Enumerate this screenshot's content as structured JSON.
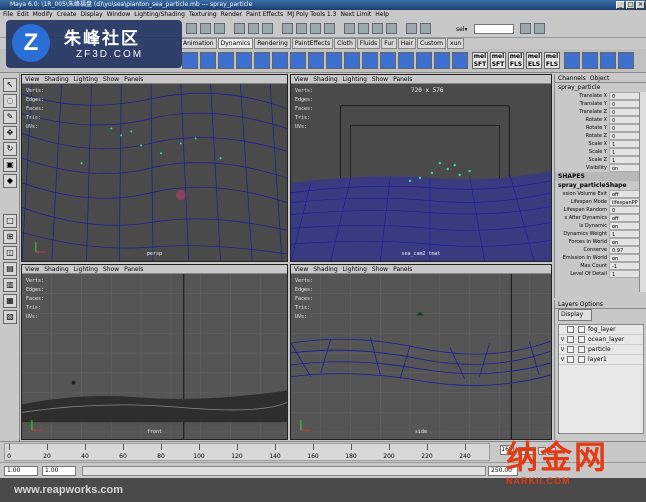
{
  "window": {
    "title": "Maya 6.0: \\1R_005\\朱峰福盘 (d)\\yu\\sea\\pianton_sea_particle.mb  ---  spray_particle",
    "buttons": [
      "_",
      "□",
      "×"
    ]
  },
  "menubar": [
    "File",
    "Edit",
    "Modify",
    "Create",
    "Display",
    "Window",
    "Lighting/Shading",
    "Texturing",
    "Render",
    "Paint Effects",
    "MJ Poly Tools 1.3",
    "Next Limit",
    "Help"
  ],
  "statusline": {
    "set_label": "sel▾",
    "set_value": ""
  },
  "shelf": {
    "tabs": [
      "Animation",
      "Dynamics",
      "Rendering",
      "PaintEffects",
      "Cloth",
      "Fluids",
      "Fur",
      "Hair",
      "Custom",
      "xun"
    ],
    "active_tab": "Dynamics",
    "text_icons": [
      "mel",
      "mel",
      "mel",
      "mel",
      "mel"
    ],
    "text_icon_sub": [
      "SFT",
      "SFT",
      "FLS",
      "ELS",
      "FLS"
    ]
  },
  "viewports": [
    {
      "menu": [
        "View",
        "Shading",
        "Lighting",
        "Show",
        "Panels"
      ],
      "label": "persp",
      "hud_labels": [
        "Verts:",
        "Edges:",
        "Faces:",
        "Tris:",
        "UVs:"
      ]
    },
    {
      "menu": [
        "View",
        "Shading",
        "Lighting",
        "Show",
        "Panels"
      ],
      "label": "sea_cam2 tmat",
      "resolution": "720 x 576",
      "hud_labels": [
        "Verts:",
        "Edges:",
        "Faces:",
        "Tris:",
        "UVs:"
      ]
    },
    {
      "menu": [
        "View",
        "Shading",
        "Lighting",
        "Show",
        "Panels"
      ],
      "label": "front",
      "hud_labels": [
        "Verts:",
        "Edges:",
        "Faces:",
        "Tris:",
        "UVs:"
      ]
    },
    {
      "menu": [
        "View",
        "Shading",
        "Lighting",
        "Show",
        "Panels"
      ],
      "label": "side",
      "hud_labels": [
        "Verts:",
        "Edges:",
        "Faces:",
        "Tris:",
        "UVs:"
      ]
    }
  ],
  "channelbox": {
    "tabs": [
      "Channels",
      "Object"
    ],
    "object": "spray_particle",
    "rows": [
      {
        "label": "Translate X",
        "value": "0"
      },
      {
        "label": "Translate Y",
        "value": "0"
      },
      {
        "label": "Translate Z",
        "value": "0"
      },
      {
        "label": "Rotate X",
        "value": "0"
      },
      {
        "label": "Rotate Y",
        "value": "0"
      },
      {
        "label": "Rotate Z",
        "value": "0"
      },
      {
        "label": "Scale X",
        "value": "1"
      },
      {
        "label": "Scale Y",
        "value": "1"
      },
      {
        "label": "Scale Z",
        "value": "1"
      },
      {
        "label": "Visibility",
        "value": "on"
      }
    ],
    "shapes_header": "SHAPES",
    "shape_name": "spray_particleShape",
    "shape_rows": [
      {
        "label": "ssion Volume Exit",
        "value": "off"
      },
      {
        "label": "Lifespan Mode",
        "value": "lifespanPP o"
      },
      {
        "label": "Lifespan Random",
        "value": "0"
      },
      {
        "label": "s After Dynamics",
        "value": "off"
      },
      {
        "label": "Is Dynamic",
        "value": "on"
      },
      {
        "label": "Dynamics Weight",
        "value": "1"
      },
      {
        "label": "Forces In World",
        "value": "on"
      },
      {
        "label": "Conserve",
        "value": "0.97"
      },
      {
        "label": "Emission In World",
        "value": "on"
      },
      {
        "label": "Max Count",
        "value": "-1"
      },
      {
        "label": "Level Of Detail",
        "value": "1"
      }
    ]
  },
  "layers": {
    "header": "Layers  Options",
    "display": "Display",
    "items": [
      {
        "v": "",
        "name": "fog_layer"
      },
      {
        "v": "V",
        "name": "ocean_layer"
      },
      {
        "v": "V",
        "name": "particle"
      },
      {
        "v": "V",
        "name": "layer1"
      }
    ]
  },
  "timeslider": {
    "ticks": [
      "0",
      "20",
      "40",
      "60",
      "80",
      "100",
      "120",
      "140",
      "160",
      "180",
      "200",
      "220",
      "240"
    ],
    "current": "169"
  },
  "rangeslider": {
    "start": "1.00",
    "playback_start": "1.00",
    "end": "250.00"
  },
  "watermarks": {
    "logo1_cn": "朱峰社区",
    "logo1_en": "ZF3D.COM",
    "logo1_mark": "Z",
    "logo2_cn": "纳金网",
    "logo2_en": "NARKII.COM",
    "footer": "www.reapworks.com"
  },
  "colors": {
    "viewport_bg": "#4a4a4a",
    "wire": "#1a1aa0",
    "particle": "#45d8a8",
    "titlebar": "#1c3f73",
    "brand_red": "#e23a12"
  }
}
